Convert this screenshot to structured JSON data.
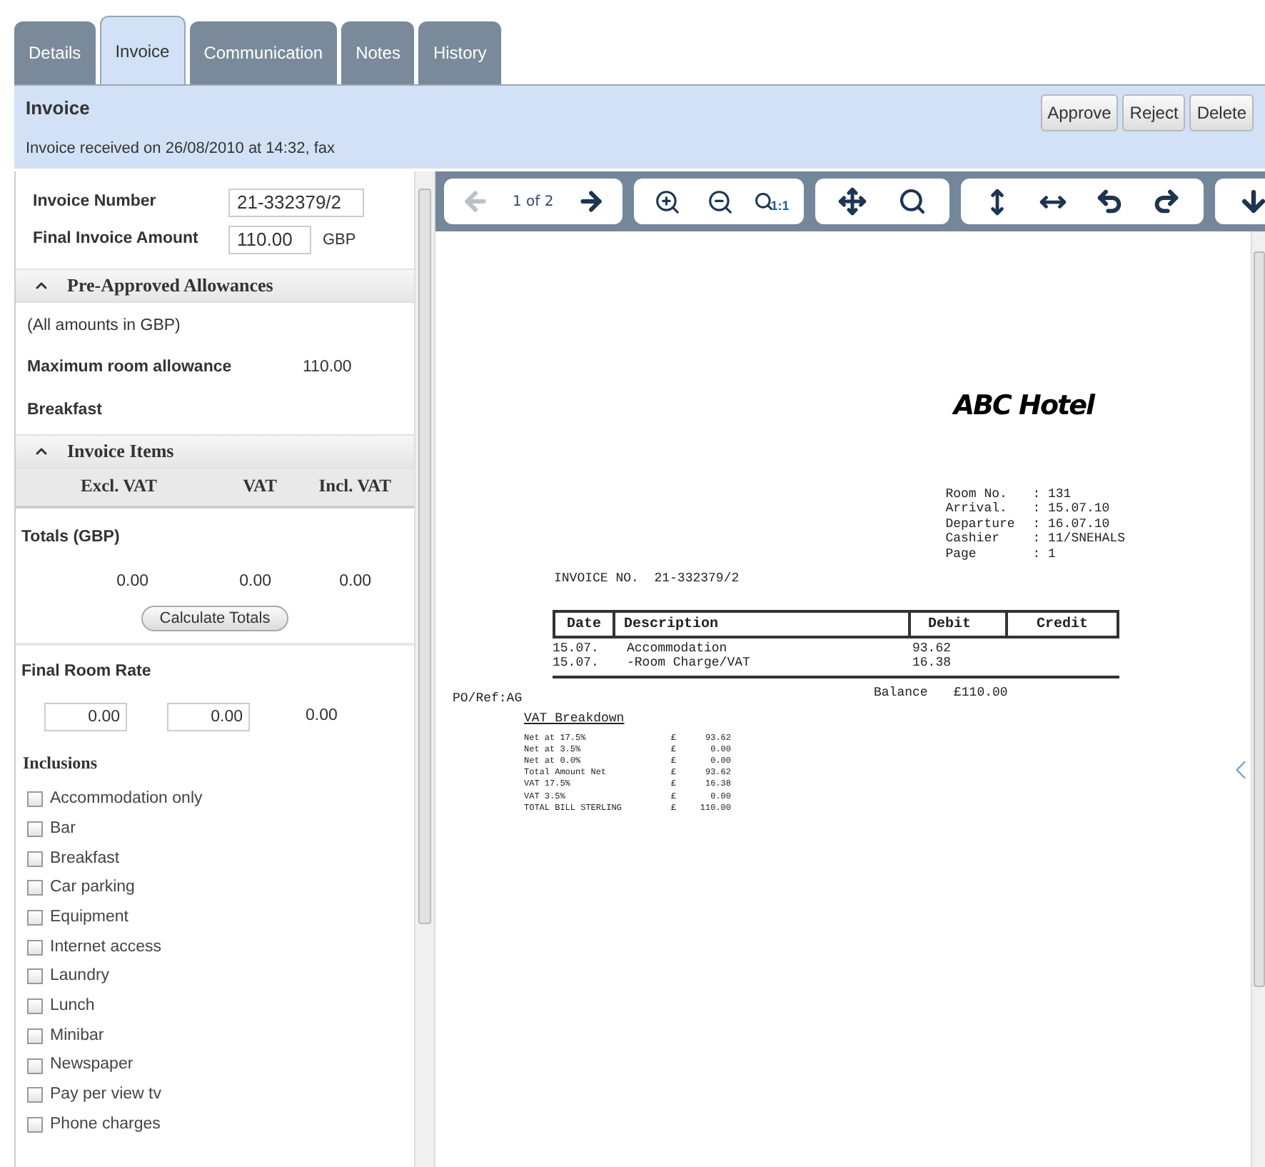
{
  "tabs": [
    {
      "label": "Details",
      "selected": false
    },
    {
      "label": "Invoice",
      "selected": true
    },
    {
      "label": "Communication",
      "selected": false
    },
    {
      "label": "Notes",
      "selected": false
    },
    {
      "label": "History",
      "selected": false
    }
  ],
  "header": {
    "title": "Invoice",
    "subtitle": "Invoice received on 26/08/2010 at 14:32, fax",
    "buttons": [
      "Approve",
      "Reject",
      "Delete"
    ]
  },
  "fields": [
    {
      "label": "Invoice Number",
      "value": "21-332379/2"
    },
    {
      "label": "Final Invoice Amount",
      "value": "110.00",
      "unit": "GBP"
    }
  ],
  "allowances": {
    "title": "Pre-Approved Allowances",
    "expanded": true,
    "note": "(All amounts in GBP)",
    "rows": [
      {
        "label": "Maximum room allowance",
        "value": "110.00"
      },
      {
        "label": "Breakfast"
      }
    ]
  },
  "invoice_items": {
    "title": "Invoice Items",
    "expanded": true,
    "columns": [
      "Excl. VAT",
      "VAT",
      "Incl. VAT"
    ],
    "totals_label": "Totals (GBP)",
    "totals": [
      "0.00",
      "0.00",
      "0.00"
    ],
    "button": "Calculate Totals"
  },
  "final_room_rate": {
    "label": "Final Room Rate",
    "inputs": [
      "0.00",
      "0.00"
    ],
    "value": "0.00"
  },
  "inclusions": {
    "label": "Inclusions",
    "items": [
      {
        "label": "Accommodation only",
        "checked": false
      },
      {
        "label": "Bar",
        "checked": false
      },
      {
        "label": "Breakfast",
        "checked": false
      },
      {
        "label": "Car parking",
        "checked": false
      },
      {
        "label": "Equipment",
        "checked": false
      },
      {
        "label": "Internet access",
        "checked": false
      },
      {
        "label": "Laundry",
        "checked": false
      },
      {
        "label": "Lunch",
        "checked": false
      },
      {
        "label": "Minibar",
        "checked": false
      },
      {
        "label": "Newspaper",
        "checked": false
      },
      {
        "label": "Pay per view tv",
        "checked": false
      },
      {
        "label": "Phone charges",
        "checked": false
      }
    ]
  },
  "toolbar": {
    "prev_disabled": true,
    "page": "1 of 2",
    "next_disabled": false,
    "actual_size_label": "1:1"
  },
  "document": {
    "hotel": "ABC Hotel",
    "info": [
      {
        "label": "Room No.",
        "value": ": 131"
      },
      {
        "label": "Arrival.",
        "value": ": 15.07.10"
      },
      {
        "label": "Departure",
        "value": ": 16.07.10"
      },
      {
        "label": "Cashier",
        "value": ": 11/SNEHALS"
      },
      {
        "label": "Page",
        "value": ": 1"
      }
    ],
    "invoice_no": "INVOICE NO.  21-332379/2",
    "columns": [
      "Date",
      "Description",
      "Debit",
      "Credit"
    ],
    "rows": [
      {
        "date": "15.07.",
        "description": "Accommodation",
        "debit": "93.62"
      },
      {
        "date": "15.07.",
        "description": "-Room Charge/VAT",
        "debit": "16.38"
      }
    ],
    "po_ref": "PO/Ref:AG",
    "balance_label": "Balance",
    "balance": "£110.00",
    "vat_title": "VAT Breakdown",
    "vat_rows": [
      {
        "label": "Net at 17.5%",
        "currency": "£",
        "amount": "93.62"
      },
      {
        "label": "Net at 3.5%",
        "currency": "£",
        "amount": "0.00"
      },
      {
        "label": "Net at 0.0%",
        "currency": "£",
        "amount": "0.00"
      },
      {
        "label": "Total Amount Net",
        "currency": "£",
        "amount": "93.62"
      },
      {
        "label": "VAT 17.5%",
        "currency": "£",
        "amount": "16.38"
      },
      {
        "label": "VAT 3.5%",
        "currency": "£",
        "amount": "0.00"
      },
      {
        "label": "TOTAL BILL STERLING",
        "currency": "£",
        "amount": "110.00"
      }
    ]
  }
}
